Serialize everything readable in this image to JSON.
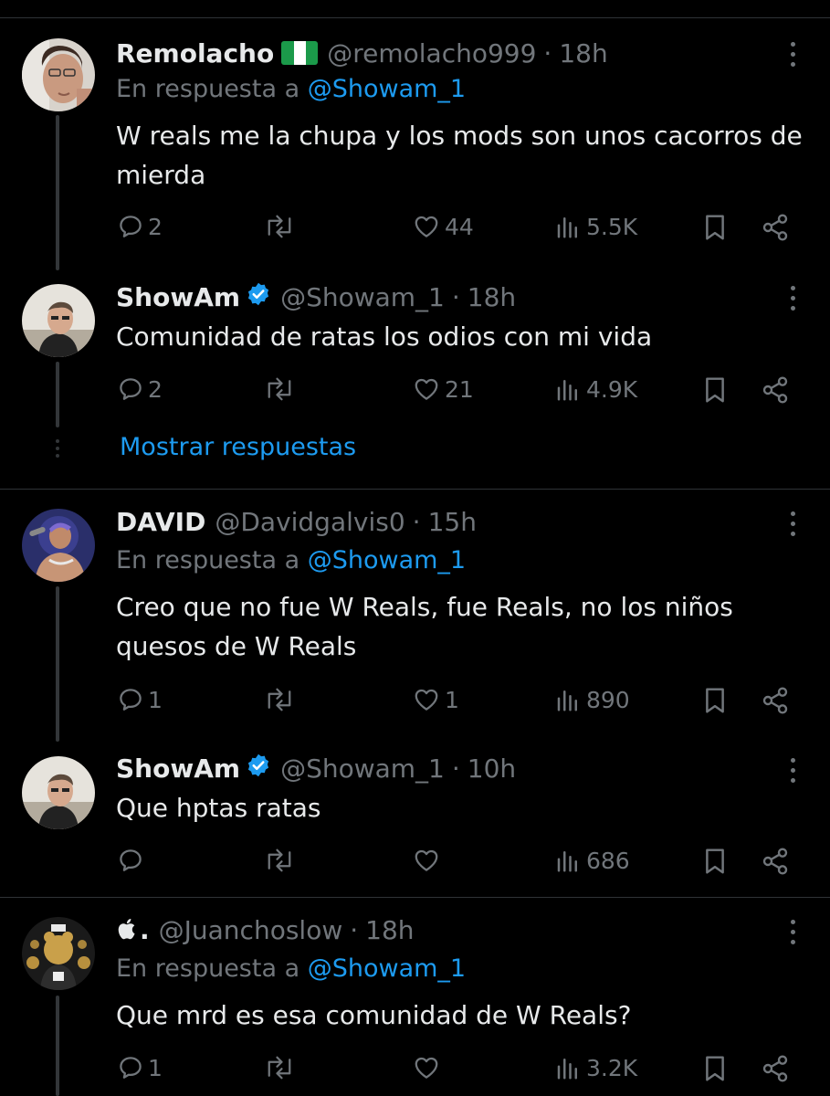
{
  "tweets": [
    {
      "name": "Remolacho",
      "handle": "@remolacho999",
      "time": "18h",
      "reply_prefix": "En respuesta a",
      "reply_to": "@Showam_1",
      "text": "W reals me la chupa y los mods son unos cacorros de mierda",
      "replies": "2",
      "retweets": "",
      "likes": "44",
      "views": "5.5K",
      "flag": "nigeria-flag-icon"
    },
    {
      "name": "ShowAm",
      "handle": "@Showam_1",
      "time": "18h",
      "text": "Comunidad de ratas los odios con mi vida",
      "replies": "2",
      "retweets": "",
      "likes": "21",
      "views": "4.9K",
      "verified": true
    },
    {
      "name": "DAVID",
      "handle": "@Davidgalvis0",
      "time": "15h",
      "reply_prefix": "En respuesta a",
      "reply_to": "@Showam_1",
      "text": "Creo que no fue W Reals, fue Reals, no los niños quesos de W Reals",
      "replies": "1",
      "retweets": "",
      "likes": "1",
      "views": "890"
    },
    {
      "name": "ShowAm",
      "handle": "@Showam_1",
      "time": "10h",
      "text": "Que hptas ratas",
      "replies": "",
      "retweets": "",
      "likes": "",
      "views": "686",
      "verified": true
    },
    {
      "name": "",
      "name_icon": "apple-logo-icon",
      "handle": "@Juanchoslow",
      "time": "18h",
      "reply_prefix": "En respuesta a",
      "reply_to": "@Showam_1",
      "text": "Que mrd es esa comunidad de W Reals?",
      "replies": "1",
      "retweets": "",
      "likes": "",
      "views": "3.2K"
    }
  ],
  "show_replies_label": "Mostrar respuestas",
  "separator": "·",
  "colors": {
    "background": "#000000",
    "text": "#e7e9ea",
    "muted": "#71767b",
    "accent": "#1d9bf0",
    "divider": "#2f3336"
  }
}
